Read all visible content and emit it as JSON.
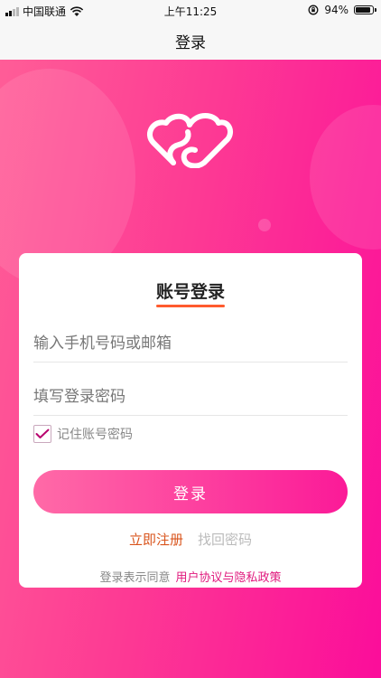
{
  "status_bar": {
    "carrier": "中国联通",
    "time": "上午11:25",
    "battery_percent": "94%",
    "battery_level": 0.94,
    "icons": [
      "signal-icon",
      "wifi-icon",
      "orientation-lock-icon",
      "battery-icon"
    ]
  },
  "nav": {
    "title": "登录"
  },
  "logo": {
    "icon": "heart-s-logo-icon"
  },
  "card": {
    "title": "账号登录",
    "phone_placeholder": "输入手机号码或邮箱",
    "password_placeholder": "填写登录密码",
    "remember_label": "记住账号密码",
    "remember_checked": true,
    "login_button": "登录",
    "register_link": "立即注册",
    "forgot_link": "找回密码",
    "agree_prefix": "登录表示同意",
    "agree_policy": "用户协议与隐私政策"
  },
  "colors": {
    "pink_start": "#ff5d97",
    "pink_end": "#fb0d9a",
    "underline": "#ff5b2e",
    "register": "#d9541c",
    "policy": "#e0197d"
  }
}
